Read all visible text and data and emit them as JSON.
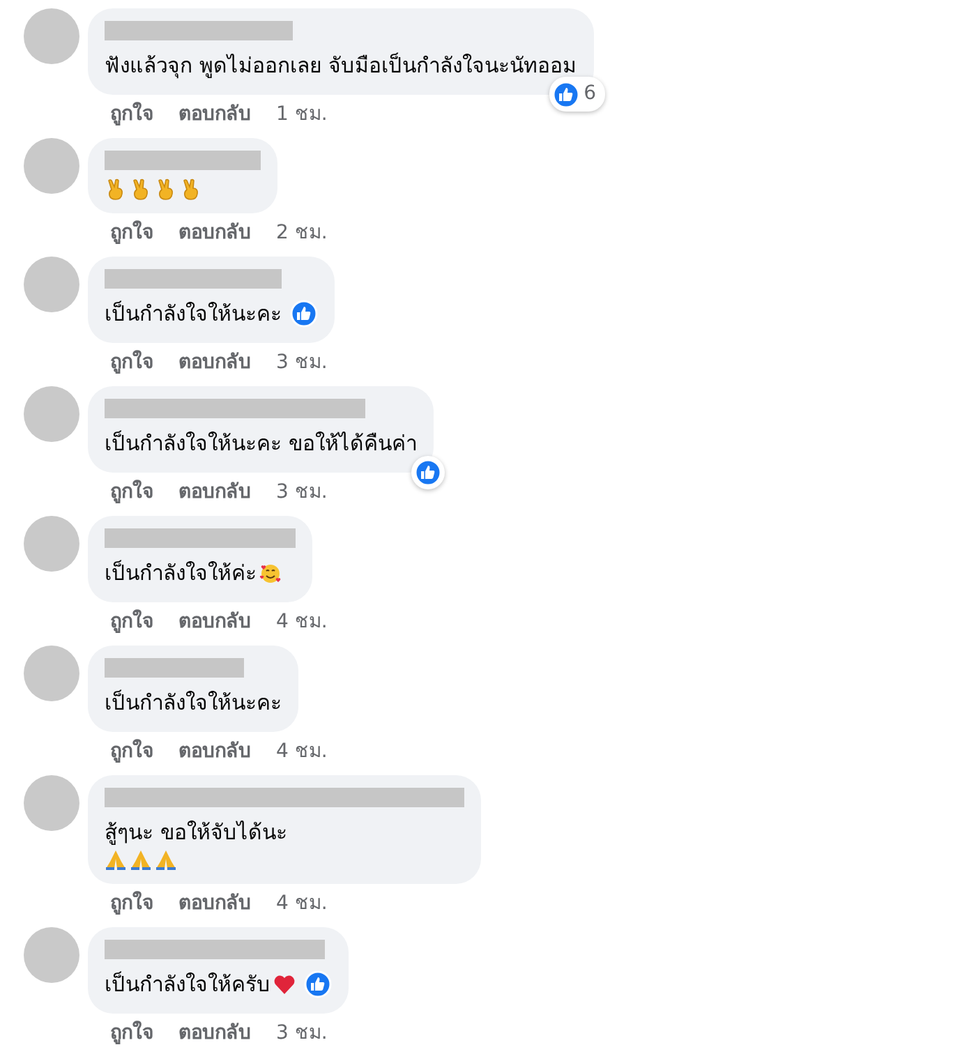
{
  "comments": [
    {
      "lines": [
        [
          {
            "kind": "text",
            "text": "ฟังแล้วจุก พูดไม่ออกเลย จับมือเป็นกำลังใจนะนัทออม"
          }
        ]
      ],
      "reaction": {
        "kind": "corner",
        "count": "6"
      },
      "actions": [
        "ถูกใจ",
        "ตอบกลับ"
      ],
      "time": "1 ชม."
    },
    {
      "lines": [
        [
          {
            "kind": "victory"
          },
          {
            "kind": "victory"
          },
          {
            "kind": "victory"
          },
          {
            "kind": "victory"
          }
        ]
      ],
      "actions": [
        "ถูกใจ",
        "ตอบกลับ"
      ],
      "time": "2 ชม."
    },
    {
      "lines": [
        [
          {
            "kind": "text",
            "text": "เป็นกำลังใจให้นะคะ"
          }
        ]
      ],
      "reaction": {
        "kind": "inline"
      },
      "actions": [
        "ถูกใจ",
        "ตอบกลับ"
      ],
      "time": "3 ชม."
    },
    {
      "lines": [
        [
          {
            "kind": "text",
            "text": "เป็นกำลังใจให้นะคะ ขอให้ได้คืนค่า"
          }
        ]
      ],
      "reaction": {
        "kind": "corner"
      },
      "actions": [
        "ถูกใจ",
        "ตอบกลับ"
      ],
      "time": "3 ชม."
    },
    {
      "lines": [
        [
          {
            "kind": "text",
            "text": "เป็นกำลังใจให้ค่ะ"
          },
          {
            "kind": "hearts-face"
          }
        ]
      ],
      "actions": [
        "ถูกใจ",
        "ตอบกลับ"
      ],
      "time": "4 ชม."
    },
    {
      "lines": [
        [
          {
            "kind": "text",
            "text": "เป็นกำลังใจให้นะคะ"
          }
        ]
      ],
      "actions": [
        "ถูกใจ",
        "ตอบกลับ"
      ],
      "time": "4 ชม."
    },
    {
      "lines": [
        [
          {
            "kind": "text",
            "text": "สู้ๆนะ ขอให้จับได้นะ"
          }
        ],
        [
          {
            "kind": "pray"
          },
          {
            "kind": "pray"
          },
          {
            "kind": "pray"
          }
        ]
      ],
      "actions": [
        "ถูกใจ",
        "ตอบกลับ"
      ],
      "time": "4 ชม."
    },
    {
      "lines": [
        [
          {
            "kind": "text",
            "text": "เป็นกำลังใจให้ครับ"
          },
          {
            "kind": "heart"
          }
        ]
      ],
      "reaction": {
        "kind": "inline"
      },
      "actions": [
        "ถูกใจ",
        "ตอบกลับ"
      ],
      "time": "3 ชม."
    }
  ]
}
